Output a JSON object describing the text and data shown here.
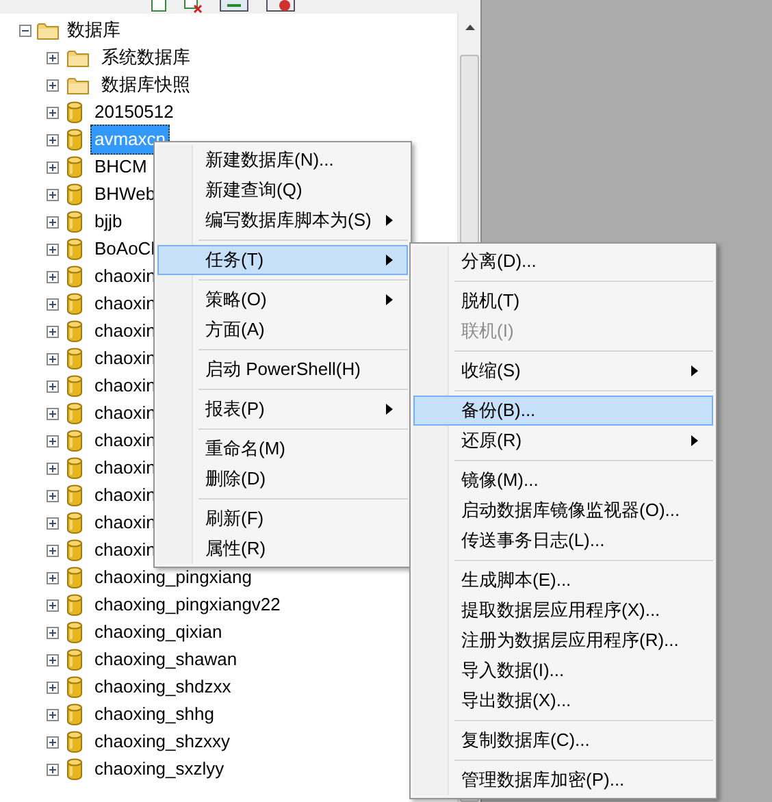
{
  "tree": {
    "root": {
      "label": "数据库",
      "expanded": true
    },
    "children": [
      {
        "label": "系统数据库",
        "kind": "folder",
        "selected": false
      },
      {
        "label": "数据库快照",
        "kind": "folder",
        "selected": false
      },
      {
        "label": "20150512",
        "kind": "database",
        "selected": false
      },
      {
        "label": "avmaxcn",
        "kind": "database",
        "selected": true
      },
      {
        "label": "BHCM",
        "kind": "database",
        "selected": false
      },
      {
        "label": "BHWeb",
        "kind": "database",
        "selected": false
      },
      {
        "label": "bjjb",
        "kind": "database",
        "selected": false
      },
      {
        "label": "BoAoCl",
        "kind": "database",
        "selected": false
      },
      {
        "label": "chaoxin",
        "kind": "database",
        "selected": false
      },
      {
        "label": "chaoxin",
        "kind": "database",
        "selected": false
      },
      {
        "label": "chaoxin",
        "kind": "database",
        "selected": false
      },
      {
        "label": "chaoxin",
        "kind": "database",
        "selected": false
      },
      {
        "label": "chaoxin",
        "kind": "database",
        "selected": false
      },
      {
        "label": "chaoxin",
        "kind": "database",
        "selected": false
      },
      {
        "label": "chaoxin",
        "kind": "database",
        "selected": false
      },
      {
        "label": "chaoxin",
        "kind": "database",
        "selected": false
      },
      {
        "label": "chaoxin",
        "kind": "database",
        "selected": false
      },
      {
        "label": "chaoxin",
        "kind": "database",
        "selected": false
      },
      {
        "label": "chaoxin",
        "kind": "database",
        "selected": false
      },
      {
        "label": "chaoxing_pingxiang",
        "kind": "database",
        "selected": false
      },
      {
        "label": "chaoxing_pingxiangv22",
        "kind": "database",
        "selected": false
      },
      {
        "label": "chaoxing_qixian",
        "kind": "database",
        "selected": false
      },
      {
        "label": "chaoxing_shawan",
        "kind": "database",
        "selected": false
      },
      {
        "label": "chaoxing_shdzxx",
        "kind": "database",
        "selected": false
      },
      {
        "label": "chaoxing_shhg",
        "kind": "database",
        "selected": false
      },
      {
        "label": "chaoxing_shzxxy",
        "kind": "database",
        "selected": false
      },
      {
        "label": "chaoxing_sxzlyy",
        "kind": "database",
        "selected": false
      }
    ]
  },
  "context_menu": [
    {
      "kind": "item",
      "label": "新建数据库(N)...",
      "selected": false,
      "submenu": false
    },
    {
      "kind": "item",
      "label": "新建查询(Q)",
      "selected": false,
      "submenu": false
    },
    {
      "kind": "item",
      "label": "编写数据库脚本为(S)",
      "selected": false,
      "submenu": true
    },
    {
      "kind": "separator"
    },
    {
      "kind": "item",
      "label": "任务(T)",
      "selected": true,
      "submenu": true
    },
    {
      "kind": "separator"
    },
    {
      "kind": "item",
      "label": "策略(O)",
      "selected": false,
      "submenu": true
    },
    {
      "kind": "item",
      "label": "方面(A)",
      "selected": false,
      "submenu": false
    },
    {
      "kind": "separator"
    },
    {
      "kind": "item",
      "label": "启动 PowerShell(H)",
      "selected": false,
      "submenu": false
    },
    {
      "kind": "separator"
    },
    {
      "kind": "item",
      "label": "报表(P)",
      "selected": false,
      "submenu": true
    },
    {
      "kind": "separator"
    },
    {
      "kind": "item",
      "label": "重命名(M)",
      "selected": false,
      "submenu": false
    },
    {
      "kind": "item",
      "label": "删除(D)",
      "selected": false,
      "submenu": false
    },
    {
      "kind": "separator"
    },
    {
      "kind": "item",
      "label": "刷新(F)",
      "selected": false,
      "submenu": false
    },
    {
      "kind": "item",
      "label": "属性(R)",
      "selected": false,
      "submenu": false
    }
  ],
  "tasks_submenu": [
    {
      "kind": "item",
      "label": "分离(D)...",
      "selected": false,
      "disabled": false,
      "submenu": false
    },
    {
      "kind": "separator"
    },
    {
      "kind": "item",
      "label": "脱机(T)",
      "selected": false,
      "disabled": false,
      "submenu": false
    },
    {
      "kind": "item",
      "label": "联机(I)",
      "selected": false,
      "disabled": true,
      "submenu": false
    },
    {
      "kind": "separator"
    },
    {
      "kind": "item",
      "label": "收缩(S)",
      "selected": false,
      "disabled": false,
      "submenu": true
    },
    {
      "kind": "separator"
    },
    {
      "kind": "item",
      "label": "备份(B)...",
      "selected": true,
      "disabled": false,
      "submenu": false
    },
    {
      "kind": "item",
      "label": "还原(R)",
      "selected": false,
      "disabled": false,
      "submenu": true
    },
    {
      "kind": "separator"
    },
    {
      "kind": "item",
      "label": "镜像(M)...",
      "selected": false,
      "disabled": false,
      "submenu": false
    },
    {
      "kind": "item",
      "label": "启动数据库镜像监视器(O)...",
      "selected": false,
      "disabled": false,
      "submenu": false
    },
    {
      "kind": "item",
      "label": "传送事务日志(L)...",
      "selected": false,
      "disabled": false,
      "submenu": false
    },
    {
      "kind": "separator"
    },
    {
      "kind": "item",
      "label": "生成脚本(E)...",
      "selected": false,
      "disabled": false,
      "submenu": false
    },
    {
      "kind": "item",
      "label": "提取数据层应用程序(X)...",
      "selected": false,
      "disabled": false,
      "submenu": false
    },
    {
      "kind": "item",
      "label": "注册为数据层应用程序(R)...",
      "selected": false,
      "disabled": false,
      "submenu": false
    },
    {
      "kind": "item",
      "label": "导入数据(I)...",
      "selected": false,
      "disabled": false,
      "submenu": false
    },
    {
      "kind": "item",
      "label": "导出数据(X)...",
      "selected": false,
      "disabled": false,
      "submenu": false
    },
    {
      "kind": "separator"
    },
    {
      "kind": "item",
      "label": "复制数据库(C)...",
      "selected": false,
      "disabled": false,
      "submenu": false
    },
    {
      "kind": "separator"
    },
    {
      "kind": "item",
      "label": "管理数据库加密(P)...",
      "selected": false,
      "disabled": false,
      "submenu": false
    }
  ]
}
